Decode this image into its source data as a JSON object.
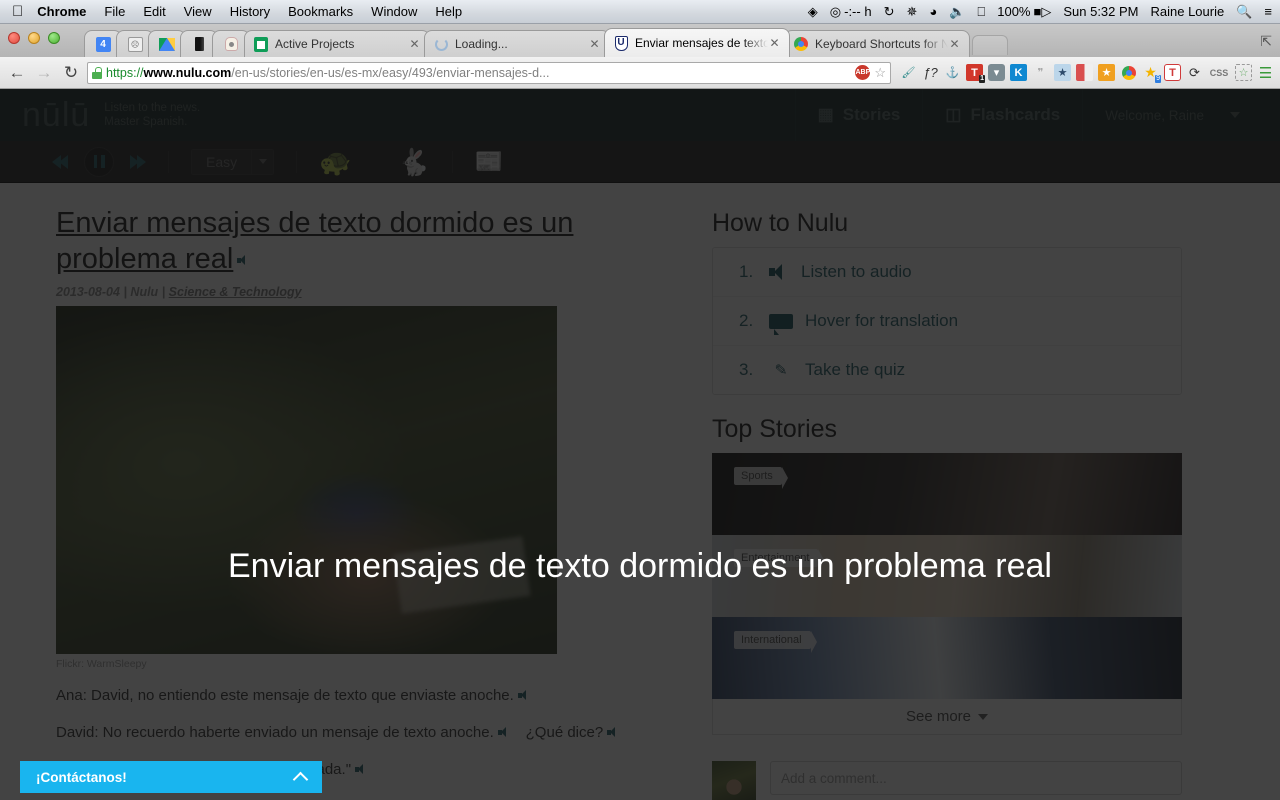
{
  "menubar": {
    "apple_icon": "apple-icon",
    "items": [
      {
        "label": "Chrome",
        "bold": true
      },
      {
        "label": "File",
        "bold": false
      },
      {
        "label": "Edit",
        "bold": false
      },
      {
        "label": "View",
        "bold": false
      },
      {
        "label": "History",
        "bold": false
      },
      {
        "label": "Bookmarks",
        "bold": false
      },
      {
        "label": "Window",
        "bold": false
      },
      {
        "label": "Help",
        "bold": false
      }
    ],
    "status": {
      "dropbox_icon": "dropbox-icon",
      "timer_icon": "timer-icon",
      "timer_text": "-:-- h",
      "sync_icon": "sync-icon",
      "bluetooth_icon": "bluetooth-icon",
      "wifi_icon": "wifi-icon",
      "volume_icon": "volume-icon",
      "keyboard_icon": "keyboard-icon",
      "battery_text": "100%",
      "battery_icon": "battery-icon",
      "clock": "Sun 5:32 PM",
      "user": "Raine Lourie",
      "search_icon": "spotlight-search-icon",
      "notifications_icon": "notification-center-icon"
    }
  },
  "browser": {
    "window_controls": [
      "close",
      "minimize",
      "zoom"
    ],
    "pinned_tabs": [
      {
        "name": "calendar-tab",
        "icon": "calendar-icon",
        "glyph": "4"
      },
      {
        "name": "crashed-tab",
        "icon": "sad-tab-icon",
        "glyph": "x x"
      },
      {
        "name": "drive-tab",
        "icon": "google-drive-icon",
        "glyph": ""
      },
      {
        "name": "dark-tab",
        "icon": "book-icon",
        "glyph": ""
      },
      {
        "name": "bot-tab",
        "icon": "robot-icon",
        "glyph": ""
      }
    ],
    "tabs": [
      {
        "title": "Active Projects",
        "icon": "google-sheets-icon",
        "active": false,
        "closable": true
      },
      {
        "title": "Loading...",
        "icon": "loading-spinner-icon",
        "active": false,
        "closable": true
      },
      {
        "title": "Enviar mensajes de texto d",
        "icon": "nulu-icon",
        "active": true,
        "closable": true
      },
      {
        "title": "Keyboard Shortcuts for Nu",
        "icon": "chrome-icon",
        "active": false,
        "closable": true
      }
    ],
    "new_tab_label": "",
    "fullscreen_icon": "fullscreen-icon",
    "toolbar": {
      "back_icon": "back-arrow-icon",
      "forward_icon": "forward-arrow-icon",
      "reload_icon": "reload-icon",
      "lock_icon": "lock-icon",
      "url_scheme": "https://",
      "url_host": "www.nulu.com",
      "url_path": "/en-us/stories/en-us/es-mx/easy/493/enviar-mensajes-d...",
      "adblock_badge": "ABP",
      "bookmark_star_icon": "star-outline-icon",
      "extensions": [
        {
          "name": "eyedropper-extension",
          "glyph": "✒"
        },
        {
          "name": "font-finder-extension",
          "glyph": "ƒ?"
        },
        {
          "name": "anchor-extension",
          "glyph": "⚓"
        },
        {
          "name": "todoist-extension",
          "glyph": "T",
          "badge": "1"
        },
        {
          "name": "shield-extension",
          "glyph": "⌄"
        },
        {
          "name": "kippt-extension",
          "glyph": "K"
        },
        {
          "name": "hangouts-extension",
          "glyph": "”"
        },
        {
          "name": "star-blue-extension",
          "glyph": "★"
        },
        {
          "name": "pocket-extension",
          "glyph": ""
        },
        {
          "name": "star-orange-extension",
          "glyph": "★"
        },
        {
          "name": "chrome-extension",
          "glyph": ""
        },
        {
          "name": "star-badge-extension",
          "glyph": "★",
          "badge": "9"
        },
        {
          "name": "trello-extension",
          "glyph": "T"
        },
        {
          "name": "clock-extension",
          "glyph": "⟳"
        },
        {
          "name": "css-extension",
          "glyph": "CSS"
        },
        {
          "name": "evernote-extension",
          "glyph": "⬚"
        },
        {
          "name": "menu-extension",
          "glyph": "☰"
        }
      ]
    }
  },
  "site": {
    "logo": "nūlū",
    "tagline_line1": "Listen to the news.",
    "tagline_line2": "Master Spanish.",
    "nav": [
      {
        "label": "Stories",
        "icon": "stories-icon"
      },
      {
        "label": "Flashcards",
        "icon": "flashcards-icon"
      }
    ],
    "welcome": "Welcome,  Raine",
    "welcome_caret_icon": "chevron-down-icon"
  },
  "player": {
    "rewind_icon": "rewind-icon",
    "pause_icon": "pause-icon",
    "forward_icon": "fast-forward-icon",
    "level_label": "Easy",
    "level_caret_icon": "chevron-down-icon",
    "slow_icon": "turtle-icon",
    "fast_icon": "rabbit-icon",
    "view_icon": "news-view-icon"
  },
  "article": {
    "title": "Enviar mensajes de texto dormido es un problema real",
    "title_audio_icon": "speaker-icon",
    "date": "2013-08-04",
    "source": "Nulu",
    "category": "Science & Technology",
    "meta_separator": " | ",
    "image_credit": "Flickr: WarmSleepy",
    "paragraphs": [
      {
        "text": "Ana: David, no entiendo este mensaje de texto que enviaste anoche.",
        "audio": true
      },
      {
        "text": "David: No recuerdo haberte enviado un mensaje de texto anoche.",
        "audio": true,
        "extra": "¿Qué dice?"
      },
      {
        "text": "andiosos con ensalada.\"",
        "audio": true
      }
    ]
  },
  "sidebar": {
    "howto_title": "How to Nulu",
    "howto_steps": [
      {
        "num": "1.",
        "label": "Listen to audio",
        "icon": "audio-icon"
      },
      {
        "num": "2.",
        "label": "Hover for translation",
        "icon": "speech-bubble-icon"
      },
      {
        "num": "3.",
        "label": "Take the quiz",
        "icon": "pencil-icon"
      }
    ],
    "topstories_title": "Top Stories",
    "stories": [
      {
        "tag": "Sports",
        "name": "top-story-1"
      },
      {
        "tag": "Entertainment",
        "name": "top-story-2"
      },
      {
        "tag": "International",
        "name": "top-story-3"
      }
    ],
    "see_more_label": "See more",
    "see_more_icon": "chevron-down-icon"
  },
  "comments": {
    "placeholder": "Add a comment...",
    "avatar_name": "user-avatar"
  },
  "overlay": {
    "title": "Enviar mensajes de texto dormido es un problema real"
  },
  "contact_widget": {
    "label": "¡Contáctanos!",
    "chevron_icon": "chevron-up-icon"
  },
  "colors": {
    "brand_dark": "#0b2120",
    "brand_teal": "#1d5a63",
    "contact_blue": "#19b5ef",
    "overlay": "rgba(20,20,20,0.80)"
  }
}
